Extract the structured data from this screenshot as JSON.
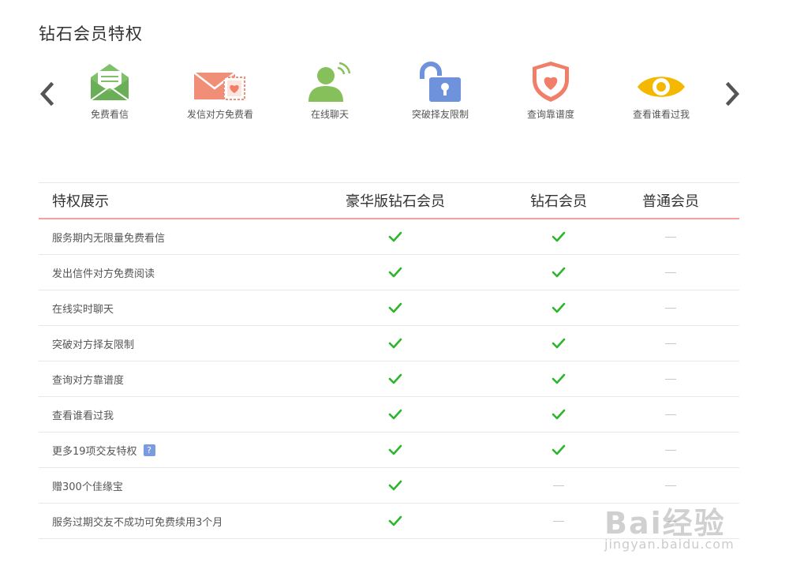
{
  "title": "钻石会员特权",
  "carousel": {
    "prev_icon": "chevron-left-icon",
    "next_icon": "chevron-right-icon",
    "features": [
      {
        "label": "免费看信",
        "icon": "envelope-open-icon",
        "color": "#7fc06b"
      },
      {
        "label": "发信对方免费看",
        "icon": "envelope-stamp-icon",
        "color": "#f08e78"
      },
      {
        "label": "在线聊天",
        "icon": "user-online-icon",
        "color": "#86c05a"
      },
      {
        "label": "突破择友限制",
        "icon": "unlock-icon",
        "color": "#6f92dc"
      },
      {
        "label": "查询靠谱度",
        "icon": "shield-heart-icon",
        "color": "#f07e68"
      },
      {
        "label": "查看谁看过我",
        "icon": "eye-icon",
        "color": "#f5b800"
      }
    ]
  },
  "table": {
    "headers": [
      "特权展示",
      "豪华版钻石会员",
      "钻石会员",
      "普通会员"
    ],
    "rows": [
      {
        "label": "服务期内无限量免费看信",
        "values": [
          true,
          true,
          false
        ]
      },
      {
        "label": "发出信件对方免费阅读",
        "values": [
          true,
          true,
          false
        ]
      },
      {
        "label": "在线实时聊天",
        "values": [
          true,
          true,
          false
        ]
      },
      {
        "label": "突破对方择友限制",
        "values": [
          true,
          true,
          false
        ]
      },
      {
        "label": "查询对方靠谱度",
        "values": [
          true,
          true,
          false
        ]
      },
      {
        "label": "查看谁看过我",
        "values": [
          true,
          true,
          false
        ]
      },
      {
        "label": "更多19项交友特权",
        "values": [
          true,
          true,
          false
        ],
        "help": "?"
      },
      {
        "label": "赠300个佳缘宝",
        "values": [
          true,
          false,
          false
        ]
      },
      {
        "label": "服务过期交友不成功可免费续用3个月",
        "values": [
          true,
          false,
          false
        ]
      }
    ],
    "check_color": "#2db52d"
  },
  "watermark": {
    "text": "Bai经验",
    "url": "jingyan.baidu.com"
  }
}
